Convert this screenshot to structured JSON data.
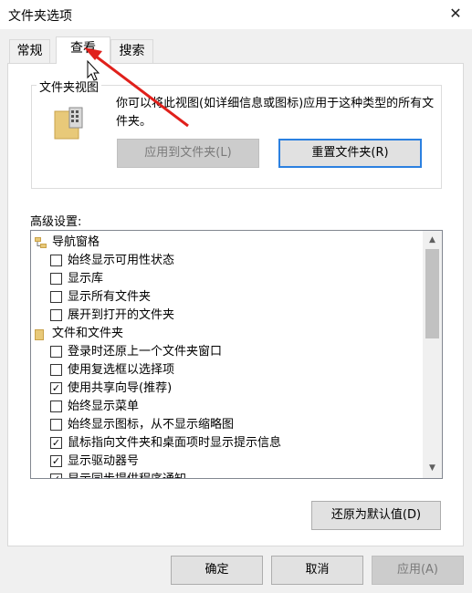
{
  "window": {
    "title": "文件夹选项",
    "close_glyph": "✕"
  },
  "tabs": [
    {
      "label": "常规",
      "active": false
    },
    {
      "label": "查看",
      "active": true
    },
    {
      "label": "搜索",
      "active": false
    }
  ],
  "folder_views": {
    "legend": "文件夹视图",
    "description": "你可以将此视图(如详细信息或图标)应用于这种类型的所有文件夹。",
    "apply_button": "应用到文件夹(L)",
    "reset_button": "重置文件夹(R)"
  },
  "advanced": {
    "label": "高级设置:",
    "items": [
      {
        "type": "group",
        "icon": "nav-pane-icon",
        "label": "导航窗格"
      },
      {
        "type": "check",
        "checked": false,
        "label": "始终显示可用性状态"
      },
      {
        "type": "check",
        "checked": false,
        "label": "显示库"
      },
      {
        "type": "check",
        "checked": false,
        "label": "显示所有文件夹"
      },
      {
        "type": "check",
        "checked": false,
        "label": "展开到打开的文件夹"
      },
      {
        "type": "group",
        "icon": "folder-icon",
        "label": "文件和文件夹"
      },
      {
        "type": "check",
        "checked": false,
        "label": "登录时还原上一个文件夹窗口"
      },
      {
        "type": "check",
        "checked": false,
        "label": "使用复选框以选择项"
      },
      {
        "type": "check",
        "checked": true,
        "label": "使用共享向导(推荐)"
      },
      {
        "type": "check",
        "checked": false,
        "label": "始终显示菜单"
      },
      {
        "type": "check",
        "checked": false,
        "label": "始终显示图标，从不显示缩略图"
      },
      {
        "type": "check",
        "checked": true,
        "label": "鼠标指向文件夹和桌面项时显示提示信息"
      },
      {
        "type": "check",
        "checked": true,
        "label": "显示驱动器号"
      },
      {
        "type": "check",
        "checked": true,
        "label": "显示同步提供程序通知"
      }
    ],
    "restore_button": "还原为默认值(D)"
  },
  "footer": {
    "ok_button": "确定",
    "cancel_button": "取消",
    "apply_button": "应用(A)"
  },
  "colors": {
    "accent_focus": "#2b80e0",
    "annotation_arrow": "#e0201b"
  }
}
